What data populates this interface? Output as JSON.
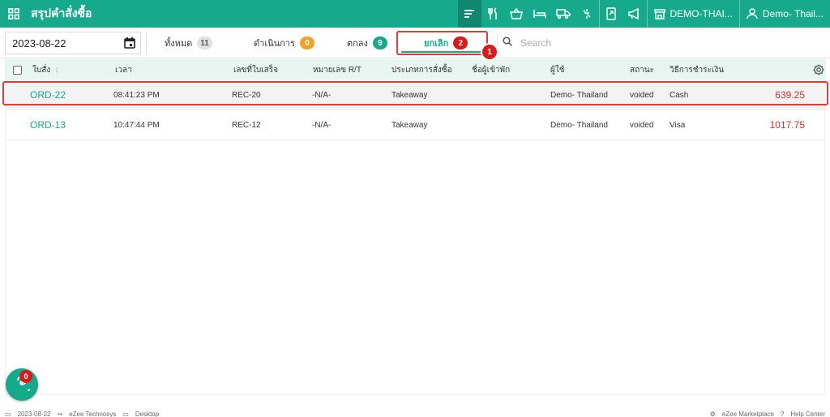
{
  "app": {
    "title": "สรุปคำสั่งซื้อ"
  },
  "topbar": {
    "icons": [
      "filter-list-icon",
      "fork-knife-icon",
      "basket-icon",
      "bed-icon",
      "truck-icon",
      "no-tag-icon",
      "mobile-share-icon",
      "megaphone-icon"
    ],
    "outlet_label": "DEMO-THAI...",
    "user_label": "Demo- Thail..."
  },
  "filters": {
    "date": "2023-08-22",
    "tabs": [
      {
        "label": "ทั้งหมด",
        "count": "11"
      },
      {
        "label": "ดำเนินการ",
        "count": "0"
      },
      {
        "label": "ตกลง",
        "count": "9"
      },
      {
        "label": "ยกเลิก",
        "count": "2"
      }
    ],
    "search_placeholder": "Search",
    "step_number": "1"
  },
  "table": {
    "headers": [
      "ใบสั่ง",
      "เวลา",
      "เลขที่ใบเสร็จ",
      "หมายเลข R/T",
      "ประเภทการสั่งซื้อ",
      "ชื่อผู้เข้าพัก",
      "ผู้ใช้",
      "สถานะ",
      "วิธีการชำระเงิน"
    ],
    "rows": [
      {
        "order": "ORD-22",
        "time": "08:41:23 PM",
        "receipt": "REC-20",
        "rt": "-N/A-",
        "type": "Takeaway",
        "guest": "",
        "user": "Demo- Thailand",
        "status": "voided",
        "payment": "Cash",
        "amount": "639.25"
      },
      {
        "order": "ORD-13",
        "time": "10:47:44 PM",
        "receipt": "REC-12",
        "rt": "-N/A-",
        "type": "Takeaway",
        "guest": "",
        "user": "Demo- Thailand",
        "status": "voided",
        "payment": "Visa",
        "amount": "1017.75"
      }
    ]
  },
  "fab": {
    "badge": "0"
  },
  "footer": {
    "date": "2023-08-22",
    "company": "eZee Technosys",
    "mode": "Desktop",
    "marketplace": "eZee Marketplace",
    "help": "Help Center"
  },
  "colors": {
    "brand": "#17a98b",
    "highlight": "#e53935",
    "amount": "#d32f2f",
    "pending": "#f4a227"
  }
}
